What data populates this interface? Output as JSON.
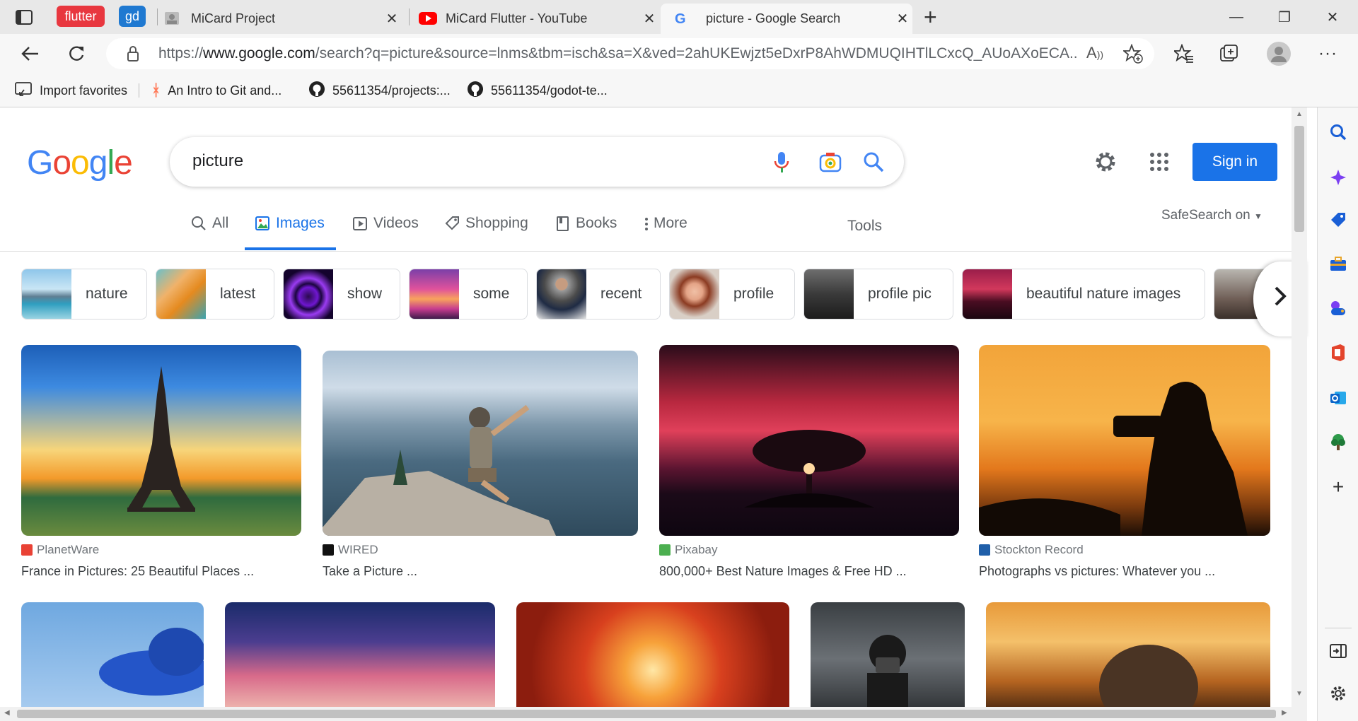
{
  "browser": {
    "tab_groups": [
      {
        "label": "flutter",
        "color": "#e8373f"
      },
      {
        "label": "gd",
        "color": "#1f79d1"
      }
    ],
    "tabs": [
      {
        "title": "MiCard Project",
        "close": "✕"
      },
      {
        "title": "MiCard Flutter - YouTube",
        "close": "✕"
      },
      {
        "title": "picture - Google Search",
        "close": "✕"
      }
    ],
    "new_tab": "+",
    "window_controls": {
      "minimize": "—",
      "maximize": "❐",
      "close": "✕"
    },
    "url": {
      "scheme": "https://",
      "domain": "www.google.com",
      "rest": "/search?q=picture&source=lnms&tbm=isch&sa=X&ved=2ahUKEwjzt5eDxrP8AhWDMUQIHTlLCxcQ_AUoAXoECA..."
    },
    "favorites": [
      {
        "label": "Import favorites"
      },
      {
        "label": "An Intro to Git and..."
      },
      {
        "label": "55611354/projects:..."
      },
      {
        "label": "55611354/godot-te..."
      }
    ]
  },
  "google": {
    "search_query": "picture",
    "sign_in": "Sign in",
    "safesearch": "SafeSearch on",
    "tools": "Tools",
    "tabs": [
      {
        "label": "All",
        "icon": "search-icon"
      },
      {
        "label": "Images",
        "icon": "image-icon"
      },
      {
        "label": "Videos",
        "icon": "play-icon"
      },
      {
        "label": "Shopping",
        "icon": "tag-icon"
      },
      {
        "label": "Books",
        "icon": "book-icon"
      },
      {
        "label": "More",
        "icon": "more-vertical-icon"
      }
    ],
    "chips": [
      {
        "label": "nature"
      },
      {
        "label": "latest"
      },
      {
        "label": "show"
      },
      {
        "label": "some"
      },
      {
        "label": "recent"
      },
      {
        "label": "profile"
      },
      {
        "label": "profile pic"
      },
      {
        "label": "beautiful nature images"
      }
    ],
    "results": [
      {
        "source": "PlanetWare",
        "caption": "France in Pictures: 25 Beautiful Places ...",
        "favicon_color": "#e94235"
      },
      {
        "source": "WIRED",
        "caption": "Take a Picture ...",
        "favicon_color": "#111111"
      },
      {
        "source": "Pixabay",
        "caption": "800,000+ Best Nature Images & Free HD ...",
        "favicon_color": "#4caf50"
      },
      {
        "source": "Stockton Record",
        "caption": "Photographs vs pictures: Whatever you ...",
        "favicon_color": "#1f5fa9"
      }
    ]
  }
}
